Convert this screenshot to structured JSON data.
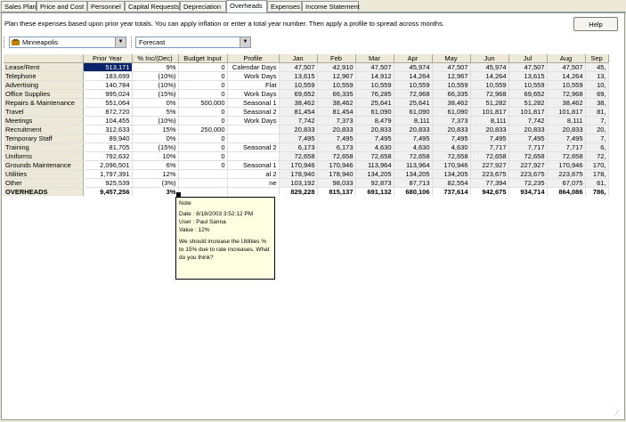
{
  "tabs": [
    "Sales Plan",
    "Price and Cost",
    "Personnel",
    "Capital Requests",
    "Depreciation",
    "Overheads",
    "Expenses",
    "Income Statement"
  ],
  "active_tab": 5,
  "instructions": "Plan these expenses based upon prior year totals.  You can apply inflation or enter a total year number.  Then apply a profile to spread across months.",
  "help_label": "Help",
  "location_combo": {
    "value": "Minneapolis",
    "icon": "building-icon"
  },
  "scenario_combo": {
    "value": "Forecast"
  },
  "grid": {
    "headers": [
      "",
      "Prior Year",
      "% Inc/(Dec)",
      "Budget Input",
      "Profile",
      "Jan",
      "Feb",
      "Mar",
      "Apr",
      "May",
      "Jun",
      "Jul",
      "Aug",
      "Sep"
    ],
    "rows": [
      {
        "name": "Lease/Rent",
        "prior": "513,171",
        "inc": "9%",
        "budget": "0",
        "profile": "Calendar Days",
        "m": [
          "47,507",
          "42,910",
          "47,507",
          "45,974",
          "47,507",
          "45,974",
          "47,507",
          "47,507",
          "45,"
        ]
      },
      {
        "name": "Telephone",
        "prior": "183,699",
        "inc": "(10%)",
        "budget": "0",
        "profile": "Work Days",
        "m": [
          "13,615",
          "12,967",
          "14,912",
          "14,264",
          "12,967",
          "14,264",
          "13,615",
          "14,264",
          "13,"
        ]
      },
      {
        "name": "Advertising",
        "prior": "140,784",
        "inc": "(10%)",
        "budget": "0",
        "profile": "Flat",
        "m": [
          "10,559",
          "10,559",
          "10,559",
          "10,559",
          "10,559",
          "10,559",
          "10,559",
          "10,559",
          "10,"
        ]
      },
      {
        "name": "Office Supplies",
        "prior": "995,024",
        "inc": "(15%)",
        "budget": "0",
        "profile": "Work Days",
        "m": [
          "69,652",
          "66,335",
          "76,285",
          "72,968",
          "66,335",
          "72,968",
          "69,652",
          "72,968",
          "69,"
        ]
      },
      {
        "name": "Repairs & Maintenance",
        "prior": "551,064",
        "inc": "0%",
        "budget": "500,000",
        "profile": "Seasonal 1",
        "m": [
          "38,462",
          "38,462",
          "25,641",
          "25,641",
          "38,462",
          "51,282",
          "51,282",
          "38,462",
          "38,"
        ]
      },
      {
        "name": "Travel",
        "prior": "872,720",
        "inc": "5%",
        "budget": "0",
        "profile": "Seasonal 2",
        "m": [
          "81,454",
          "81,454",
          "61,090",
          "61,090",
          "61,090",
          "101,817",
          "101,817",
          "101,817",
          "81,"
        ]
      },
      {
        "name": "Meetings",
        "prior": "104,455",
        "inc": "(10%)",
        "budget": "0",
        "profile": "Work Days",
        "m": [
          "7,742",
          "7,373",
          "8,479",
          "8,111",
          "7,373",
          "8,111",
          "7,742",
          "8,111",
          "7,"
        ]
      },
      {
        "name": "Recruitment",
        "prior": "312,633",
        "inc": "15%",
        "budget": "250,000",
        "profile": "",
        "m": [
          "20,833",
          "20,833",
          "20,833",
          "20,833",
          "20,833",
          "20,833",
          "20,833",
          "20,833",
          "20,"
        ]
      },
      {
        "name": "Temporary Staff",
        "prior": "89,940",
        "inc": "0%",
        "budget": "0",
        "profile": "",
        "m": [
          "7,495",
          "7,495",
          "7,495",
          "7,495",
          "7,495",
          "7,495",
          "7,495",
          "7,495",
          "7,"
        ]
      },
      {
        "name": "Training",
        "prior": "81,705",
        "inc": "(15%)",
        "budget": "0",
        "profile": "Seasonal 2",
        "m": [
          "6,173",
          "6,173",
          "4,630",
          "4,630",
          "4,630",
          "7,717",
          "7,717",
          "7,717",
          "6,"
        ]
      },
      {
        "name": "Uniforms",
        "prior": "792,632",
        "inc": "10%",
        "budget": "0",
        "profile": "",
        "m": [
          "72,658",
          "72,658",
          "72,658",
          "72,658",
          "72,658",
          "72,658",
          "72,658",
          "72,658",
          "72,"
        ]
      },
      {
        "name": "Grounds Maintenance",
        "prior": "2,096,501",
        "inc": "6%",
        "budget": "0",
        "profile": "Seasonal 1",
        "m": [
          "170,946",
          "170,946",
          "113,964",
          "113,964",
          "170,946",
          "227,927",
          "227,927",
          "170,946",
          "170,"
        ]
      },
      {
        "name": "Utilities",
        "prior": "1,797,391",
        "inc": "12%",
        "budget": "",
        "profile": "al 2",
        "m": [
          "178,940",
          "178,940",
          "134,205",
          "134,205",
          "134,205",
          "223,675",
          "223,675",
          "223,675",
          "178,"
        ]
      },
      {
        "name": "Other",
        "prior": "925,539",
        "inc": "(3%)",
        "budget": "",
        "profile": "ne",
        "m": [
          "103,192",
          "98,033",
          "92,873",
          "87,713",
          "82,554",
          "77,394",
          "72,235",
          "67,075",
          "61,"
        ]
      }
    ],
    "total": {
      "name": "OVERHEADS",
      "prior": "9,457,256",
      "inc": "3%",
      "m": [
        "829,228",
        "815,137",
        "691,132",
        "680,106",
        "737,614",
        "942,675",
        "934,714",
        "864,086",
        "786,"
      ]
    }
  },
  "note": {
    "title": "Note",
    "date": "Date : 8/18/2003 3:52:12 PM",
    "user": "User : Paul Sanna",
    "value": "Value : 12%",
    "message": "We should increase the Utilities % to 15% due to rate increases.  What do you think?"
  }
}
